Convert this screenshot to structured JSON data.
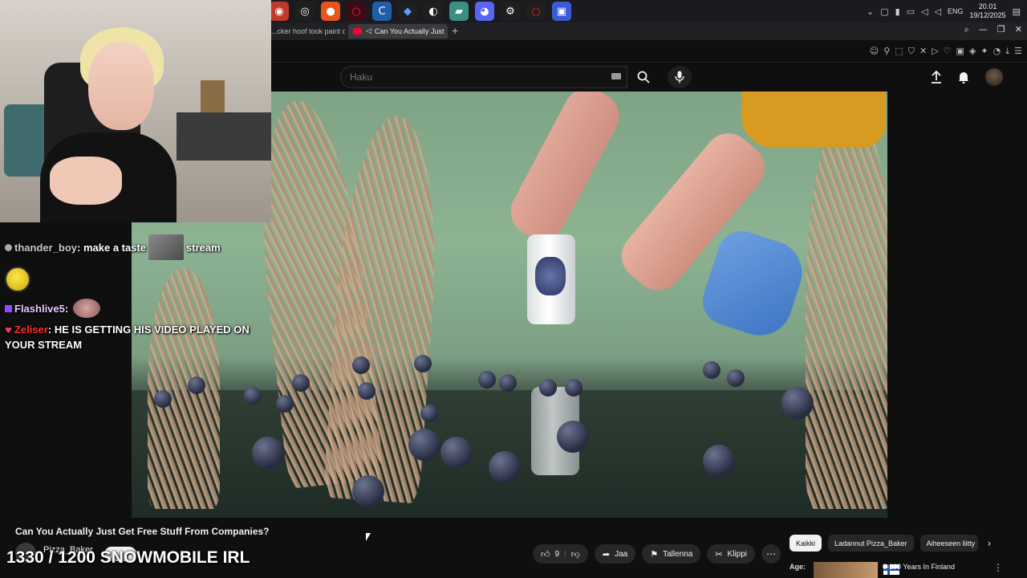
{
  "os": {
    "language": "ENG",
    "time": "20.01",
    "date": "19/12/2025",
    "taskbar_icons": [
      "obs-icon",
      "chrome-icon",
      "firefox-icon",
      "opera-gx-icon",
      "ccleaner-icon",
      "streamer-bot-icon",
      "app-icon",
      "app-icon-2",
      "discord-icon",
      "settings-icon",
      "opera-icon",
      "app-icon-3"
    ]
  },
  "browser": {
    "tab_inactive": "...cker hoof took paint off",
    "tab_active": "Can You Actually Just",
    "new_tab": "+"
  },
  "youtube": {
    "search_placeholder": "Haku",
    "video_title": "Can You Actually Just Get Free Stuff From Companies?",
    "channel_name": "Pizza_Baker",
    "actions": {
      "like_count": "9",
      "share": "Jaa",
      "save": "Tallenna",
      "clip": "Klippi"
    },
    "chips": [
      "Kaikki",
      "Ladannut Pizza_Baker",
      "Aiheeseen liitty"
    ],
    "recommended": {
      "badge": "Age:",
      "title": "0-100 Years In Finland"
    }
  },
  "stream": {
    "chat": [
      {
        "user": "thander_boy",
        "message": "make a taste",
        "after": "stream"
      },
      {
        "user": "Flashlive5",
        "message": ""
      },
      {
        "user": "Zeliser",
        "message": "HE IS GETTING HIS VIDEO PLAYED ON YOUR STREAM"
      }
    ],
    "sub_goal": "1330 / 1200 SNOWMOBILE IRL"
  },
  "colors": {
    "background": "#0f0f0f",
    "accent_red": "#ff0033",
    "chat_user_red": "#ff2d2d",
    "twitch_purple": "#9147ff"
  }
}
